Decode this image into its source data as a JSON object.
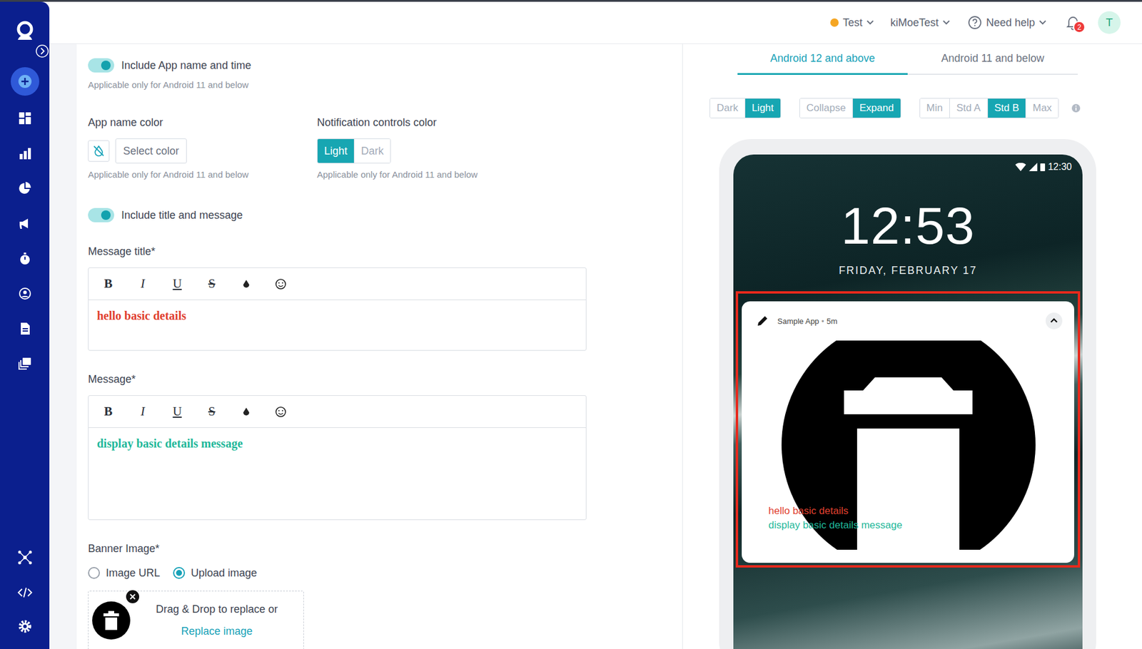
{
  "header": {
    "environment": {
      "label": "Test",
      "color": "#f5a623"
    },
    "workspace": "kiMoeTest",
    "help": "Need help",
    "notifications": {
      "count": "2"
    },
    "avatar": "T"
  },
  "form": {
    "app_name_toggle": {
      "label": "Include App name and time",
      "on": true,
      "hint": "Applicable only for Android 11 and below"
    },
    "app_name_color": {
      "label": "App name color",
      "button": "Select color",
      "hint": "Applicable only for Android 11 and below"
    },
    "controls_color": {
      "label": "Notification controls color",
      "options": [
        {
          "label": "Light",
          "selected": true
        },
        {
          "label": "Dark",
          "selected": false
        }
      ],
      "hint": "Applicable only for Android 11 and below"
    },
    "title_toggle": {
      "label": "Include title and message",
      "on": true
    },
    "toolbar": [
      "B",
      "I",
      "U",
      "S"
    ],
    "title_field": {
      "label": "Message title*",
      "value": "hello basic details",
      "color": "#e0402f"
    },
    "message_field": {
      "label": "Message*",
      "value": "display basic details message",
      "color": "#1fb89a"
    },
    "banner": {
      "label": "Banner Image*",
      "options": [
        {
          "label": "Image URL",
          "selected": false
        },
        {
          "label": "Upload image",
          "selected": true
        }
      ],
      "upload": {
        "prompt": "Drag & Drop to replace or",
        "link": "Replace image"
      }
    }
  },
  "preview": {
    "tabs": [
      {
        "label": "Android 12 and above",
        "selected": true
      },
      {
        "label": "Android 11 and below",
        "selected": false
      }
    ],
    "toggle_groups": [
      [
        {
          "label": "Dark",
          "selected": false
        },
        {
          "label": "Light",
          "selected": true
        }
      ],
      [
        {
          "label": "Collapse",
          "selected": false
        },
        {
          "label": "Expand",
          "selected": true
        }
      ],
      [
        {
          "label": "Min",
          "selected": false
        },
        {
          "label": "Std A",
          "selected": false
        },
        {
          "label": "Std B",
          "selected": true
        },
        {
          "label": "Max",
          "selected": false
        }
      ]
    ],
    "phone": {
      "status_time": "12:30",
      "clock": "12:53",
      "date": "FRIDAY, FEBRUARY 17",
      "notification": {
        "app": "Sample App",
        "separator": "•",
        "age": "5m",
        "expanded": true
      }
    }
  }
}
